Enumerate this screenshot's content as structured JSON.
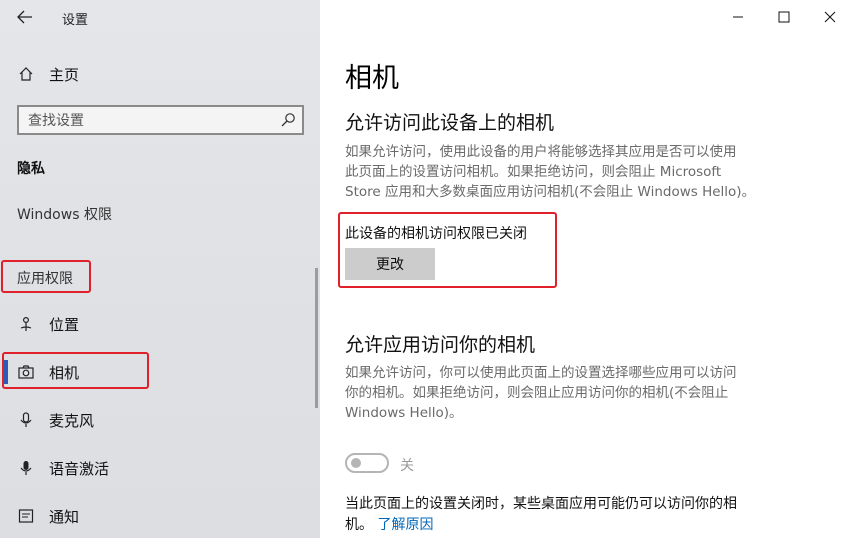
{
  "window": {
    "title": "设置"
  },
  "sidebar": {
    "back_icon": "arrow-left-icon",
    "home_label": "主页",
    "search_placeholder": "查找设置",
    "section_privacy": "隐私",
    "windows_permissions": "Windows 权限",
    "section_app_permissions": "应用权限",
    "items": [
      {
        "label": "位置",
        "icon": "location-icon"
      },
      {
        "label": "相机",
        "icon": "camera-icon",
        "active": true
      },
      {
        "label": "麦克风",
        "icon": "microphone-icon"
      },
      {
        "label": "语音激活",
        "icon": "voice-icon"
      },
      {
        "label": "通知",
        "icon": "notification-icon"
      }
    ]
  },
  "main": {
    "title": "相机",
    "section1": {
      "heading": "允许访问此设备上的相机",
      "desc_lines": [
        "如果允许访问，使用此设备的用户将能够选择其应用是否可以使用",
        "此页面上的设置访问相机。如果拒绝访问，则会阻止 Microsoft",
        "Store 应用和大多数桌面应用访问相机(不会阻止 Windows Hello)。"
      ],
      "status": "此设备的相机访问权限已关闭",
      "change_button": "更改"
    },
    "section2": {
      "heading": "允许应用访问你的相机",
      "desc_lines": [
        "如果允许访问，你可以使用此页面上的设置选择哪些应用可以访问",
        "你的相机。如果拒绝访问，则会阻止应用访问你的相机(不会阻止",
        "Windows Hello)。"
      ],
      "toggle_state": "关",
      "toggle_on": false
    },
    "note": {
      "text_line1": "当此页面上的设置关闭时，某些桌面应用可能仍可以访问你的相",
      "text_line2": "机。",
      "link": "了解原因"
    }
  },
  "colors": {
    "accent": "#2b5bb8",
    "link": "#0067b8",
    "highlight_box": "#e0202a"
  }
}
